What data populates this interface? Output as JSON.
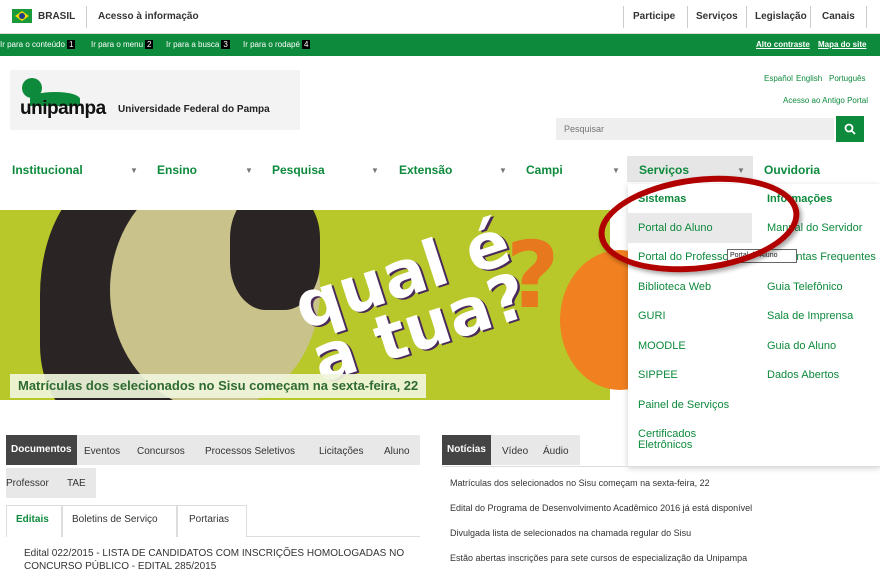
{
  "govbar": {
    "country": "BRASIL",
    "access_info": "Acesso à informação",
    "links": [
      "Participe",
      "Serviços",
      "Legislação",
      "Canais"
    ]
  },
  "accbar": {
    "items": [
      {
        "label": "Ir para o conteúdo",
        "key": "1"
      },
      {
        "label": "Ir para o menu",
        "key": "2"
      },
      {
        "label": "Ir para a busca",
        "key": "3"
      },
      {
        "label": "Ir para o rodapé",
        "key": "4"
      }
    ],
    "high_contrast": "Alto contraste",
    "sitemap": "Mapa do site"
  },
  "header": {
    "logo_word": "unipampa",
    "university_name": "Universidade Federal do Pampa",
    "languages": [
      "Español",
      "English",
      "Português"
    ],
    "old_portal": "Acesso ao Antigo Portal",
    "search_placeholder": "Pesquisar"
  },
  "nav": {
    "items": [
      "Institucional",
      "Ensino",
      "Pesquisa",
      "Extensão",
      "Campi",
      "Serviços",
      "Ouvidoria"
    ]
  },
  "hero": {
    "art_text_1": "qual é",
    "art_text_2": "a tua?",
    "art_mark": "?",
    "caption": "Matrículas dos selecionados no Sisu começam na sexta-feira, 22"
  },
  "dropdown": {
    "col1_header": "Sistemas",
    "col2_header": "Informações",
    "col1": [
      "Portal do Aluno",
      "Portal do Professor",
      "Biblioteca Web",
      "GURI",
      "MOODLE",
      "SIPPEE",
      "Painel de Serviços",
      "Certificados Eletrônicos"
    ],
    "col2": [
      "Manual do Servidor",
      "Perguntas Frequentes",
      "Guia Telefônico",
      "Sala de Imprensa",
      "Guia do Aluno",
      "Dados Abertos"
    ],
    "tooltip": "Portal do Aluno"
  },
  "left_tabs": {
    "row1": [
      "Documentos",
      "Eventos",
      "Concursos",
      "Processos Seletivos",
      "Licitações",
      "Aluno"
    ],
    "row2": [
      "Professor",
      "TAE"
    ],
    "subtabs": [
      "Editais",
      "Boletins de Serviço",
      "Portarias"
    ],
    "first_item": "Edital 022/2015 - LISTA DE CANDIDATOS COM INSCRIÇÕES HOMOLOGADAS NO CONCURSO PÚBLICO - EDITAL 285/2015"
  },
  "right_tabs": {
    "tabs": [
      "Notícias",
      "Vídeo",
      "Áudio"
    ],
    "news": [
      "Matrículas dos selecionados no Sisu começam na sexta-feira, 22",
      "Edital do Programa de Desenvolvimento Acadêmico 2016 já está disponível",
      "Divulgada lista de selecionados na chamada regular do Sisu",
      "Estão abertas inscrições para sete cursos de especialização da Unipampa"
    ]
  },
  "colors": {
    "brand_green": "#0d8a3c",
    "hero_lime": "#b8c82a",
    "highlight_red": "#b00000"
  }
}
